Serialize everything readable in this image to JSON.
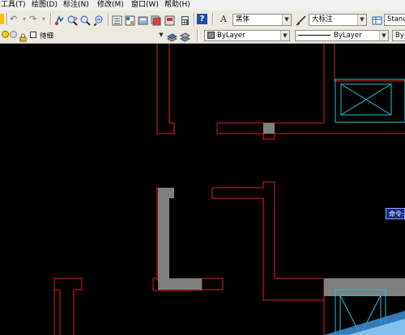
{
  "menu": [
    "工具(T)",
    "绘图(D)",
    "标注(N)",
    "修改(M)",
    "窗口(W)",
    "帮助(H)"
  ],
  "toolbar1": {
    "text_style": "黑体",
    "dim_style": "大标注",
    "table_style": "Stand"
  },
  "toolbar2": {
    "layer_name": "待细",
    "color": "ByLayer",
    "linetype": "ByLayer",
    "lineweight": "By"
  },
  "command_prompt": "命令:",
  "colors": {
    "wall": "#e0201c",
    "fill": "#7f7f7f",
    "fixture": "#19c8d2",
    "canvas": "#000000"
  }
}
